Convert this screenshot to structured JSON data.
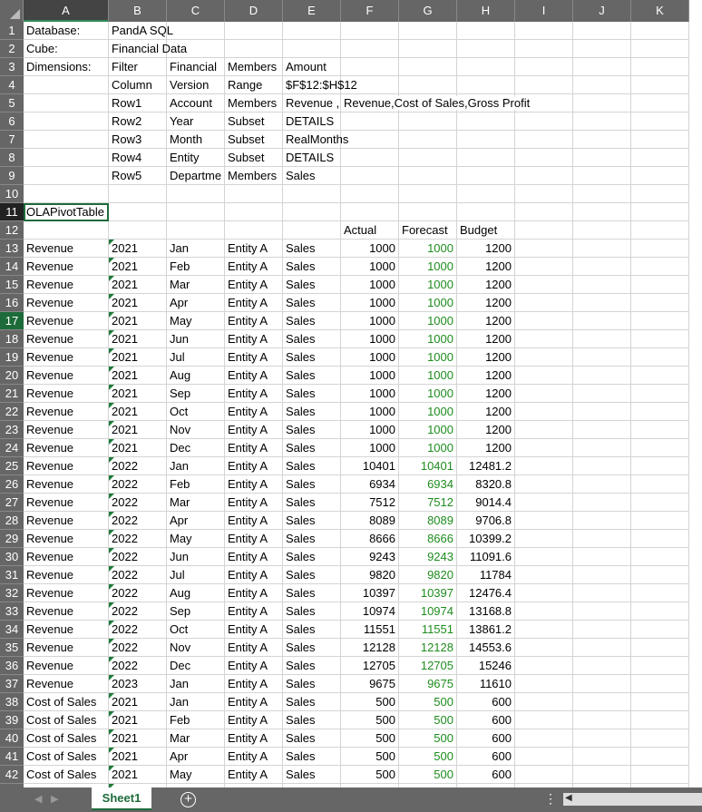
{
  "columns": [
    "A",
    "B",
    "C",
    "D",
    "E",
    "F",
    "G",
    "H",
    "I",
    "J",
    "K"
  ],
  "selected_cell": "A11",
  "active_row": 17,
  "header_rows": [
    {
      "row": 1,
      "cells": {
        "A": "Database:",
        "B": "PandA SQL"
      }
    },
    {
      "row": 2,
      "cells": {
        "A": "Cube:",
        "B": "Financial Data"
      }
    },
    {
      "row": 3,
      "cells": {
        "A": "Dimensions:",
        "B": "Filter",
        "C": "Financial",
        "D": "Members",
        "E": "Amount"
      }
    },
    {
      "row": 4,
      "cells": {
        "B": "Column",
        "C": "Version",
        "D": "Range",
        "E": "$F$12:$H$12"
      }
    },
    {
      "row": 5,
      "cells": {
        "B": "Row1",
        "C": "Account",
        "D": "Members",
        "E": "Revenue ,",
        "F": "Revenue,Cost of Sales,Gross Profit"
      }
    },
    {
      "row": 6,
      "cells": {
        "B": "Row2",
        "C": "Year",
        "D": "Subset",
        "E": "DETAILS"
      }
    },
    {
      "row": 7,
      "cells": {
        "B": "Row3",
        "C": "Month",
        "D": "Subset",
        "E": "RealMonths"
      }
    },
    {
      "row": 8,
      "cells": {
        "B": "Row4",
        "C": "Entity",
        "D": "Subset",
        "E": "DETAILS"
      }
    },
    {
      "row": 9,
      "cells": {
        "B": "Row5",
        "C": "Departme",
        "D": "Members",
        "E": "Sales"
      }
    },
    {
      "row": 10,
      "cells": {}
    },
    {
      "row": 11,
      "cells": {
        "A": "OLAPivotTable"
      }
    },
    {
      "row": 12,
      "cells": {
        "F": "Actual",
        "G": "Forecast",
        "H": "Budget"
      }
    }
  ],
  "data_rows": [
    [
      "Revenue",
      "2021",
      "Jan",
      "Entity A",
      "Sales",
      "1000",
      "1000",
      "1200"
    ],
    [
      "Revenue",
      "2021",
      "Feb",
      "Entity A",
      "Sales",
      "1000",
      "1000",
      "1200"
    ],
    [
      "Revenue",
      "2021",
      "Mar",
      "Entity A",
      "Sales",
      "1000",
      "1000",
      "1200"
    ],
    [
      "Revenue",
      "2021",
      "Apr",
      "Entity A",
      "Sales",
      "1000",
      "1000",
      "1200"
    ],
    [
      "Revenue",
      "2021",
      "May",
      "Entity A",
      "Sales",
      "1000",
      "1000",
      "1200"
    ],
    [
      "Revenue",
      "2021",
      "Jun",
      "Entity A",
      "Sales",
      "1000",
      "1000",
      "1200"
    ],
    [
      "Revenue",
      "2021",
      "Jul",
      "Entity A",
      "Sales",
      "1000",
      "1000",
      "1200"
    ],
    [
      "Revenue",
      "2021",
      "Aug",
      "Entity A",
      "Sales",
      "1000",
      "1000",
      "1200"
    ],
    [
      "Revenue",
      "2021",
      "Sep",
      "Entity A",
      "Sales",
      "1000",
      "1000",
      "1200"
    ],
    [
      "Revenue",
      "2021",
      "Oct",
      "Entity A",
      "Sales",
      "1000",
      "1000",
      "1200"
    ],
    [
      "Revenue",
      "2021",
      "Nov",
      "Entity A",
      "Sales",
      "1000",
      "1000",
      "1200"
    ],
    [
      "Revenue",
      "2021",
      "Dec",
      "Entity A",
      "Sales",
      "1000",
      "1000",
      "1200"
    ],
    [
      "Revenue",
      "2022",
      "Jan",
      "Entity A",
      "Sales",
      "10401",
      "10401",
      "12481.2"
    ],
    [
      "Revenue",
      "2022",
      "Feb",
      "Entity A",
      "Sales",
      "6934",
      "6934",
      "8320.8"
    ],
    [
      "Revenue",
      "2022",
      "Mar",
      "Entity A",
      "Sales",
      "7512",
      "7512",
      "9014.4"
    ],
    [
      "Revenue",
      "2022",
      "Apr",
      "Entity A",
      "Sales",
      "8089",
      "8089",
      "9706.8"
    ],
    [
      "Revenue",
      "2022",
      "May",
      "Entity A",
      "Sales",
      "8666",
      "8666",
      "10399.2"
    ],
    [
      "Revenue",
      "2022",
      "Jun",
      "Entity A",
      "Sales",
      "9243",
      "9243",
      "11091.6"
    ],
    [
      "Revenue",
      "2022",
      "Jul",
      "Entity A",
      "Sales",
      "9820",
      "9820",
      "11784"
    ],
    [
      "Revenue",
      "2022",
      "Aug",
      "Entity A",
      "Sales",
      "10397",
      "10397",
      "12476.4"
    ],
    [
      "Revenue",
      "2022",
      "Sep",
      "Entity A",
      "Sales",
      "10974",
      "10974",
      "13168.8"
    ],
    [
      "Revenue",
      "2022",
      "Oct",
      "Entity A",
      "Sales",
      "11551",
      "11551",
      "13861.2"
    ],
    [
      "Revenue",
      "2022",
      "Nov",
      "Entity A",
      "Sales",
      "12128",
      "12128",
      "14553.6"
    ],
    [
      "Revenue",
      "2022",
      "Dec",
      "Entity A",
      "Sales",
      "12705",
      "12705",
      "15246"
    ],
    [
      "Revenue",
      "2023",
      "Jan",
      "Entity A",
      "Sales",
      "9675",
      "9675",
      "11610"
    ],
    [
      "Cost of Sales",
      "2021",
      "Jan",
      "Entity A",
      "Sales",
      "500",
      "500",
      "600"
    ],
    [
      "Cost of Sales",
      "2021",
      "Feb",
      "Entity A",
      "Sales",
      "500",
      "500",
      "600"
    ],
    [
      "Cost of Sales",
      "2021",
      "Mar",
      "Entity A",
      "Sales",
      "500",
      "500",
      "600"
    ],
    [
      "Cost of Sales",
      "2021",
      "Apr",
      "Entity A",
      "Sales",
      "500",
      "500",
      "600"
    ],
    [
      "Cost of Sales",
      "2021",
      "May",
      "Entity A",
      "Sales",
      "500",
      "500",
      "600"
    ]
  ],
  "forecast_color": "#1e8c1e",
  "tabs": {
    "sheet": "Sheet1",
    "add": "+",
    "prev": "◀",
    "next": "▶",
    "more": "⋮"
  }
}
